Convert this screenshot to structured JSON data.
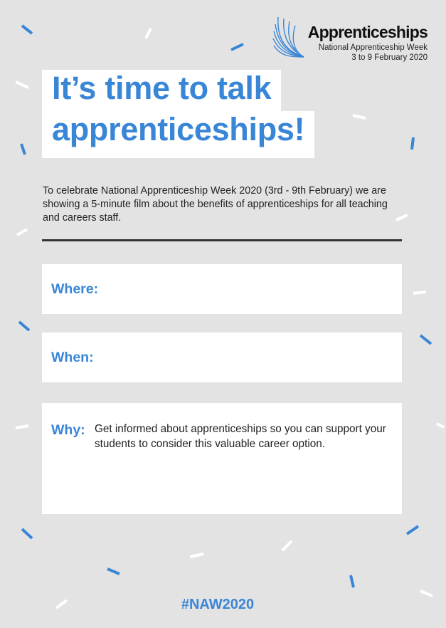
{
  "colors": {
    "accent": "#3a86d6",
    "background": "#e3e3e3",
    "panel": "#ffffff",
    "text": "#222222"
  },
  "logo": {
    "name": "Apprenticeships",
    "subtitle": "National Apprenticeship Week",
    "dates": "3 to 9 February 2020"
  },
  "headline": {
    "line1": "It’s time to talk",
    "line2": "apprenticeships!"
  },
  "intro": "To celebrate National Apprenticeship Week 2020 (3rd - 9th February) we are showing a 5-minute film about the benefits of apprenticeships for all teaching and careers staff.",
  "fields": {
    "where_label": "Where:",
    "when_label": "When:",
    "why_label": "Why:",
    "why_text": "Get informed about apprenticeships so you can support your students to consider this valuable career option."
  },
  "hashtag": "#NAW2020"
}
